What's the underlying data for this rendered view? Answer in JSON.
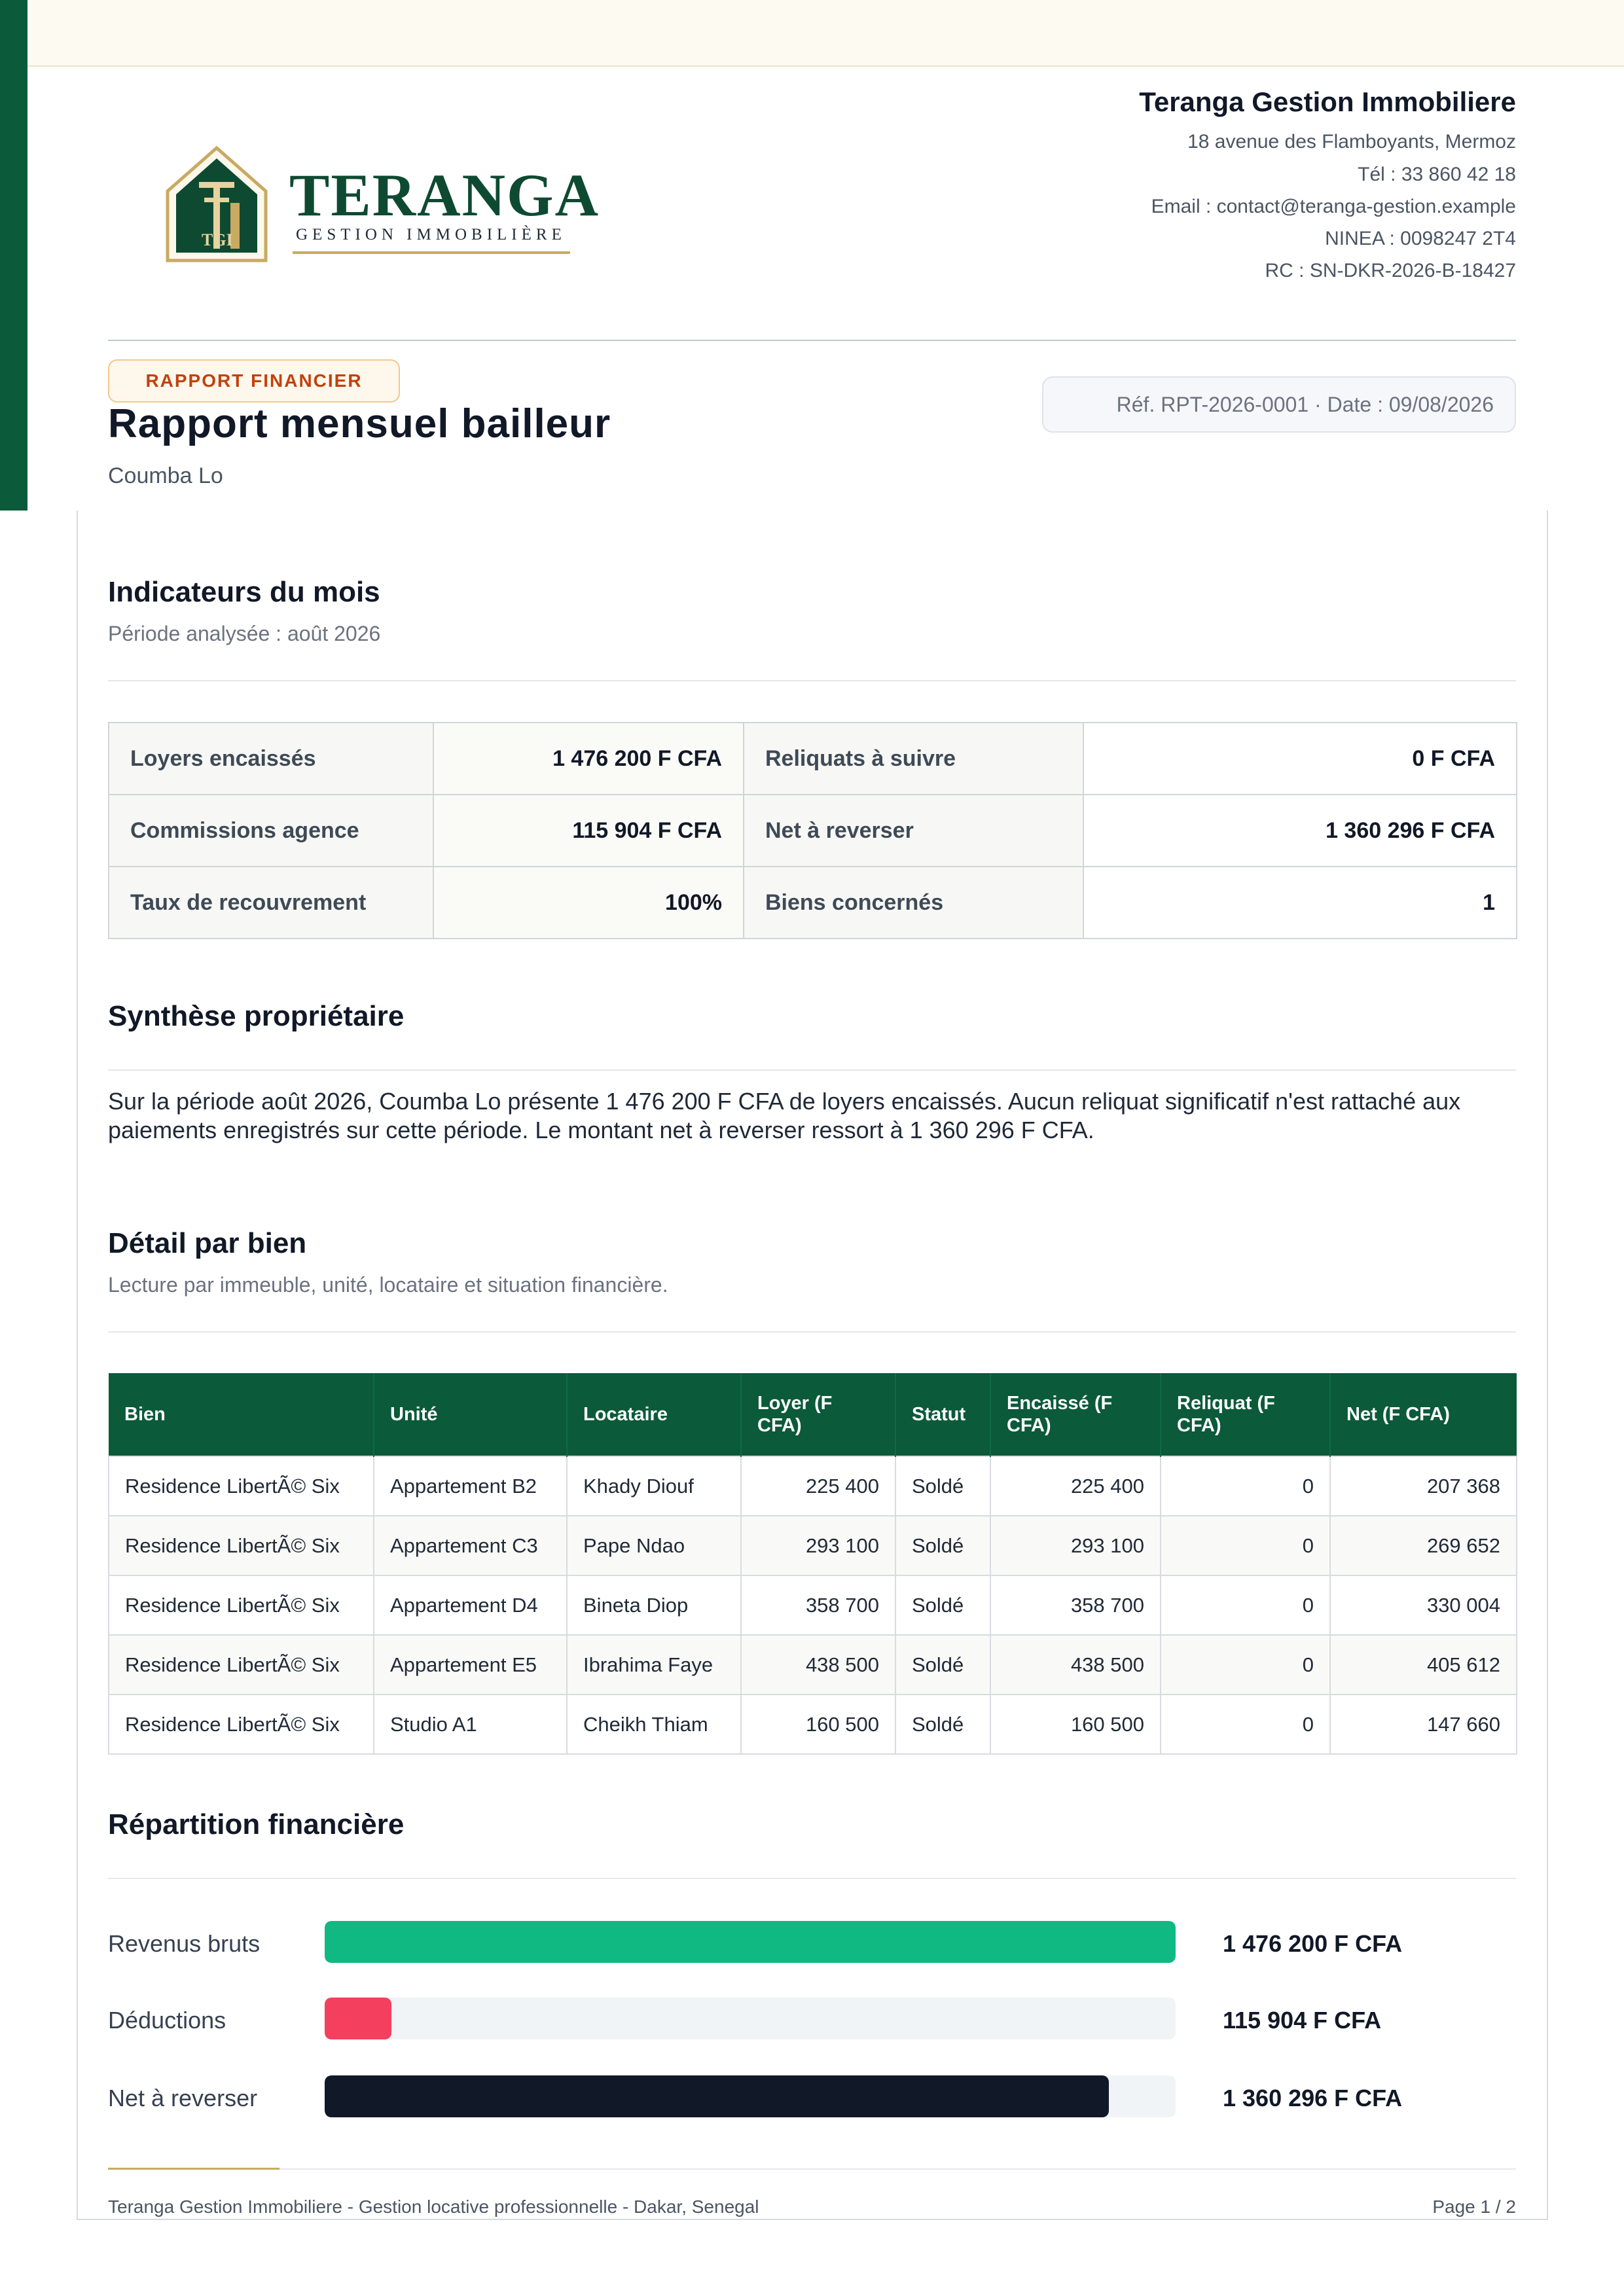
{
  "brand": {
    "logo_text": "TERANGA",
    "logo_subtitle": "GESTION IMMOBILIÈRE",
    "logo_monogram": "TGI"
  },
  "company": {
    "name": "Teranga Gestion Immobiliere",
    "address": "18 avenue des Flamboyants, Mermoz",
    "phone": "Tél : 33 860 42 18",
    "email": "Email : contact@teranga-gestion.example",
    "ninea": "NINEA : 0098247 2T4",
    "rc": "RC : SN-DKR-2026-B-18427"
  },
  "report": {
    "badge": "RAPPORT FINANCIER",
    "title": "Rapport mensuel bailleur",
    "owner": "Coumba Lo",
    "reference": "Réf. RPT-2026-0001 · Date : 09/08/2026"
  },
  "indicators": {
    "title": "Indicateurs du mois",
    "period": "Période analysée : août 2026",
    "rows": [
      [
        {
          "label": "Loyers encaissés",
          "value": "1 476 200 F CFA"
        },
        {
          "label": "Reliquats à suivre",
          "value": "0 F CFA"
        }
      ],
      [
        {
          "label": "Commissions agence",
          "value": "115 904 F CFA"
        },
        {
          "label": "Net à reverser",
          "value": "1 360 296 F CFA"
        }
      ],
      [
        {
          "label": "Taux de recouvrement",
          "value": "100%"
        },
        {
          "label": "Biens concernés",
          "value": "1"
        }
      ]
    ]
  },
  "synthesis": {
    "title": "Synthèse propriétaire",
    "text": "Sur la période août 2026, Coumba Lo présente 1 476 200 F CFA de loyers encaissés. Aucun reliquat significatif n'est rattaché aux paiements enregistrés sur cette période. Le montant net à reverser ressort à 1 360 296 F CFA."
  },
  "detail": {
    "title": "Détail par bien",
    "subtitle": "Lecture par immeuble, unité, locataire et situation financière.",
    "columns": [
      "Bien",
      "Unité",
      "Locataire",
      "Loyer (F CFA)",
      "Statut",
      "Encaissé (F CFA)",
      "Reliquat (F CFA)",
      "Net (F CFA)"
    ],
    "rows": [
      [
        "Residence LibertÃ© Six",
        "Appartement B2",
        "Khady Diouf",
        "225 400",
        "Soldé",
        "225 400",
        "0",
        "207 368"
      ],
      [
        "Residence LibertÃ© Six",
        "Appartement C3",
        "Pape Ndao",
        "293 100",
        "Soldé",
        "293 100",
        "0",
        "269 652"
      ],
      [
        "Residence LibertÃ© Six",
        "Appartement D4",
        "Bineta Diop",
        "358 700",
        "Soldé",
        "358 700",
        "0",
        "330 004"
      ],
      [
        "Residence LibertÃ© Six",
        "Appartement E5",
        "Ibrahima Faye",
        "438 500",
        "Soldé",
        "438 500",
        "0",
        "405 612"
      ],
      [
        "Residence LibertÃ© Six",
        "Studio A1",
        "Cheikh Thiam",
        "160 500",
        "Soldé",
        "160 500",
        "0",
        "147 660"
      ]
    ]
  },
  "breakdown": {
    "title": "Répartition financière",
    "bars": [
      {
        "label": "Revenus bruts",
        "amount": "1 476 200 F CFA",
        "fraction": 1.0,
        "color": "#10b981"
      },
      {
        "label": "Déductions",
        "amount": "115 904 F CFA",
        "fraction": 0.0785,
        "color": "#f43f5e"
      },
      {
        "label": "Net à reverser",
        "amount": "1 360 296 F CFA",
        "fraction": 0.9215,
        "color": "#111827"
      }
    ]
  },
  "footer": {
    "left": "Teranga Gestion Immobiliere - Gestion locative professionnelle - Dakar, Senegal",
    "page": "Page 1 / 2"
  },
  "colors": {
    "brand_green": "#0b5a3a",
    "accent_gold": "#c8aa62",
    "badge_orange": "#c2410c"
  }
}
